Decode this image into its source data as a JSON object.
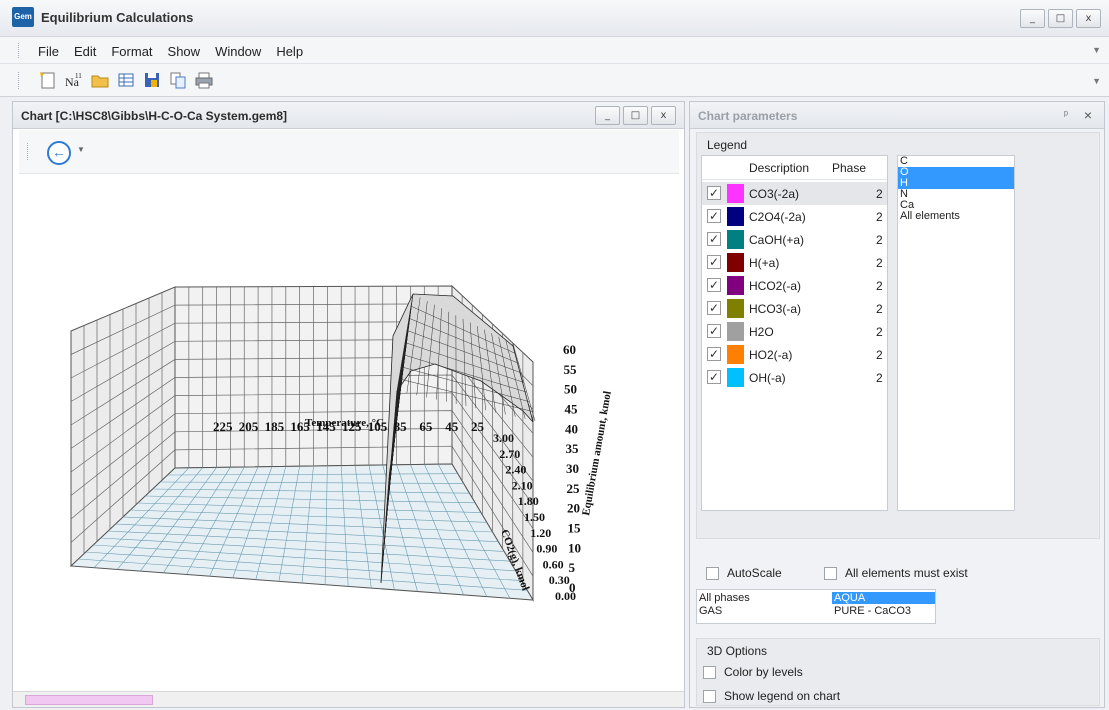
{
  "app": {
    "title": "Equilibrium Calculations",
    "icon_text": "Gem",
    "window_buttons": [
      "_",
      "□",
      "x"
    ]
  },
  "menu": [
    "File",
    "Edit",
    "Format",
    "Show",
    "Window",
    "Help"
  ],
  "toolbar": {
    "buttons": [
      "new-file-icon",
      "element-na-icon",
      "open-folder-icon",
      "table-icon",
      "save-icon",
      "copy-icon",
      "print-icon"
    ],
    "element_symbol": "Na",
    "element_number": "11"
  },
  "chart_window": {
    "title": "Chart [C:\\HSC8\\Gibbs\\H-C-O-Ca System.gem8]",
    "back_label": "←"
  },
  "chart_data": {
    "type": "surface3d",
    "x_axis": {
      "label": "Temperature, °C",
      "ticks": [
        "225",
        "205",
        "185",
        "165",
        "145",
        "125",
        "105",
        "85",
        "65",
        "45",
        "25"
      ]
    },
    "y_axis": {
      "label": "CO2(g), kmol",
      "ticks": [
        "0.00",
        "0.30",
        "0.60",
        "0.90",
        "1.20",
        "1.50",
        "1.80",
        "2.10",
        "2.40",
        "2.70",
        "3.00"
      ]
    },
    "z_axis": {
      "label": "Equilibrium amount, kmol",
      "ticks": [
        "0",
        "5",
        "10",
        "15",
        "20",
        "25",
        "30",
        "35",
        "40",
        "45",
        "50",
        "55",
        "60"
      ],
      "range": [
        0,
        60
      ]
    },
    "surface": {
      "ridge_height": 55,
      "description": "Surface near zero except a sharp rise at low CO2 forming a plateau around 55 kmol"
    }
  },
  "params": {
    "title": "Chart parameters",
    "legend_title": "Legend",
    "columns": [
      "Description",
      "Phase"
    ],
    "species": [
      {
        "name": "CO3(-2a)",
        "phase": "2",
        "color": "#ff33ff",
        "checked": true
      },
      {
        "name": "C2O4(-2a)",
        "phase": "2",
        "color": "#000080",
        "checked": true
      },
      {
        "name": "CaOH(+a)",
        "phase": "2",
        "color": "#008080",
        "checked": true
      },
      {
        "name": "H(+a)",
        "phase": "2",
        "color": "#800000",
        "checked": true
      },
      {
        "name": "HCO2(-a)",
        "phase": "2",
        "color": "#800080",
        "checked": true
      },
      {
        "name": "HCO3(-a)",
        "phase": "2",
        "color": "#808000",
        "checked": true
      },
      {
        "name": "H2O",
        "phase": "2",
        "color": "#a0a0a0",
        "checked": true
      },
      {
        "name": "HO2(-a)",
        "phase": "2",
        "color": "#ff8000",
        "checked": true
      },
      {
        "name": "OH(-a)",
        "phase": "2",
        "color": "#00c0ff",
        "checked": true
      }
    ],
    "elements": [
      {
        "label": "C",
        "selected": false
      },
      {
        "label": "O",
        "selected": true
      },
      {
        "label": "H",
        "selected": true
      },
      {
        "label": "N",
        "selected": false
      },
      {
        "label": "Ca",
        "selected": false
      },
      {
        "label": "All elements",
        "selected": false
      }
    ],
    "autoscale_label": "AutoScale",
    "all_elements_label": "All elements must exist",
    "phases": [
      {
        "label": "All phases",
        "selected": false
      },
      {
        "label": "AQUA",
        "selected": true
      },
      {
        "label": "GAS",
        "selected": false
      },
      {
        "label": "PURE - CaCO3",
        "selected": false
      }
    ],
    "opts3d_title": "3D Options",
    "color_by_levels": "Color by levels",
    "show_legend": "Show legend on chart"
  }
}
